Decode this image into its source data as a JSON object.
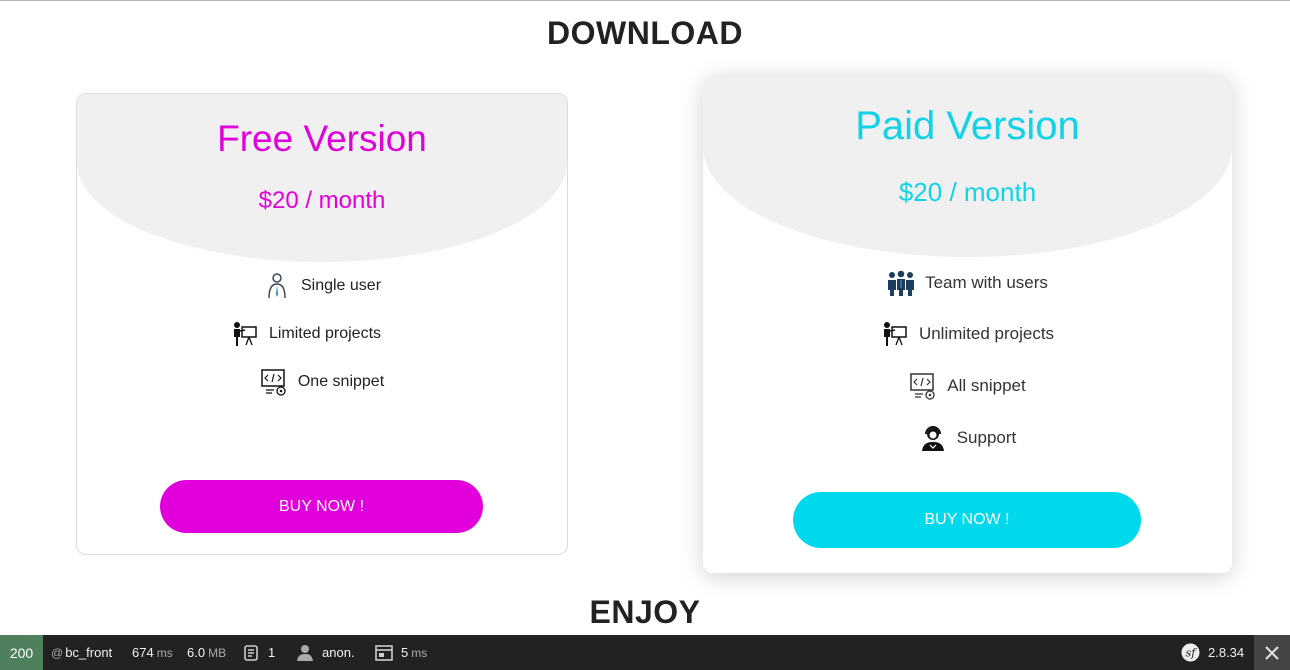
{
  "page": {
    "download_title": "DOWNLOAD",
    "enjoy_title": "ENJOY"
  },
  "plans": {
    "free": {
      "name": "Free Version",
      "price": "$20 / month",
      "accent": "#e100dc",
      "features": [
        {
          "icon": "single-user-icon",
          "label": "Single user"
        },
        {
          "icon": "presentation-icon",
          "label": "Limited projects"
        },
        {
          "icon": "code-snippet-icon",
          "label": "One snippet"
        }
      ],
      "button_label": "BUY NOW !"
    },
    "paid": {
      "name": "Paid Version",
      "price": "$20 / month",
      "accent": "#00d8ec",
      "features": [
        {
          "icon": "team-icon",
          "label": "Team with users"
        },
        {
          "icon": "presentation-icon",
          "label": "Unlimited projects"
        },
        {
          "icon": "code-snippet-icon",
          "label": "All snippet"
        },
        {
          "icon": "support-agent-icon",
          "label": "Support"
        }
      ],
      "button_label": "BUY NOW !"
    }
  },
  "toolbar": {
    "status_code": "200",
    "route_prefix": "@",
    "route": "bc_front",
    "time_value": "674",
    "time_unit": "ms",
    "memory_value": "6.0",
    "memory_unit": "MB",
    "requests_count": "1",
    "user": "anon.",
    "db_value": "5",
    "db_unit": "ms",
    "version": "2.8.34",
    "status_color": "#4f805d"
  }
}
